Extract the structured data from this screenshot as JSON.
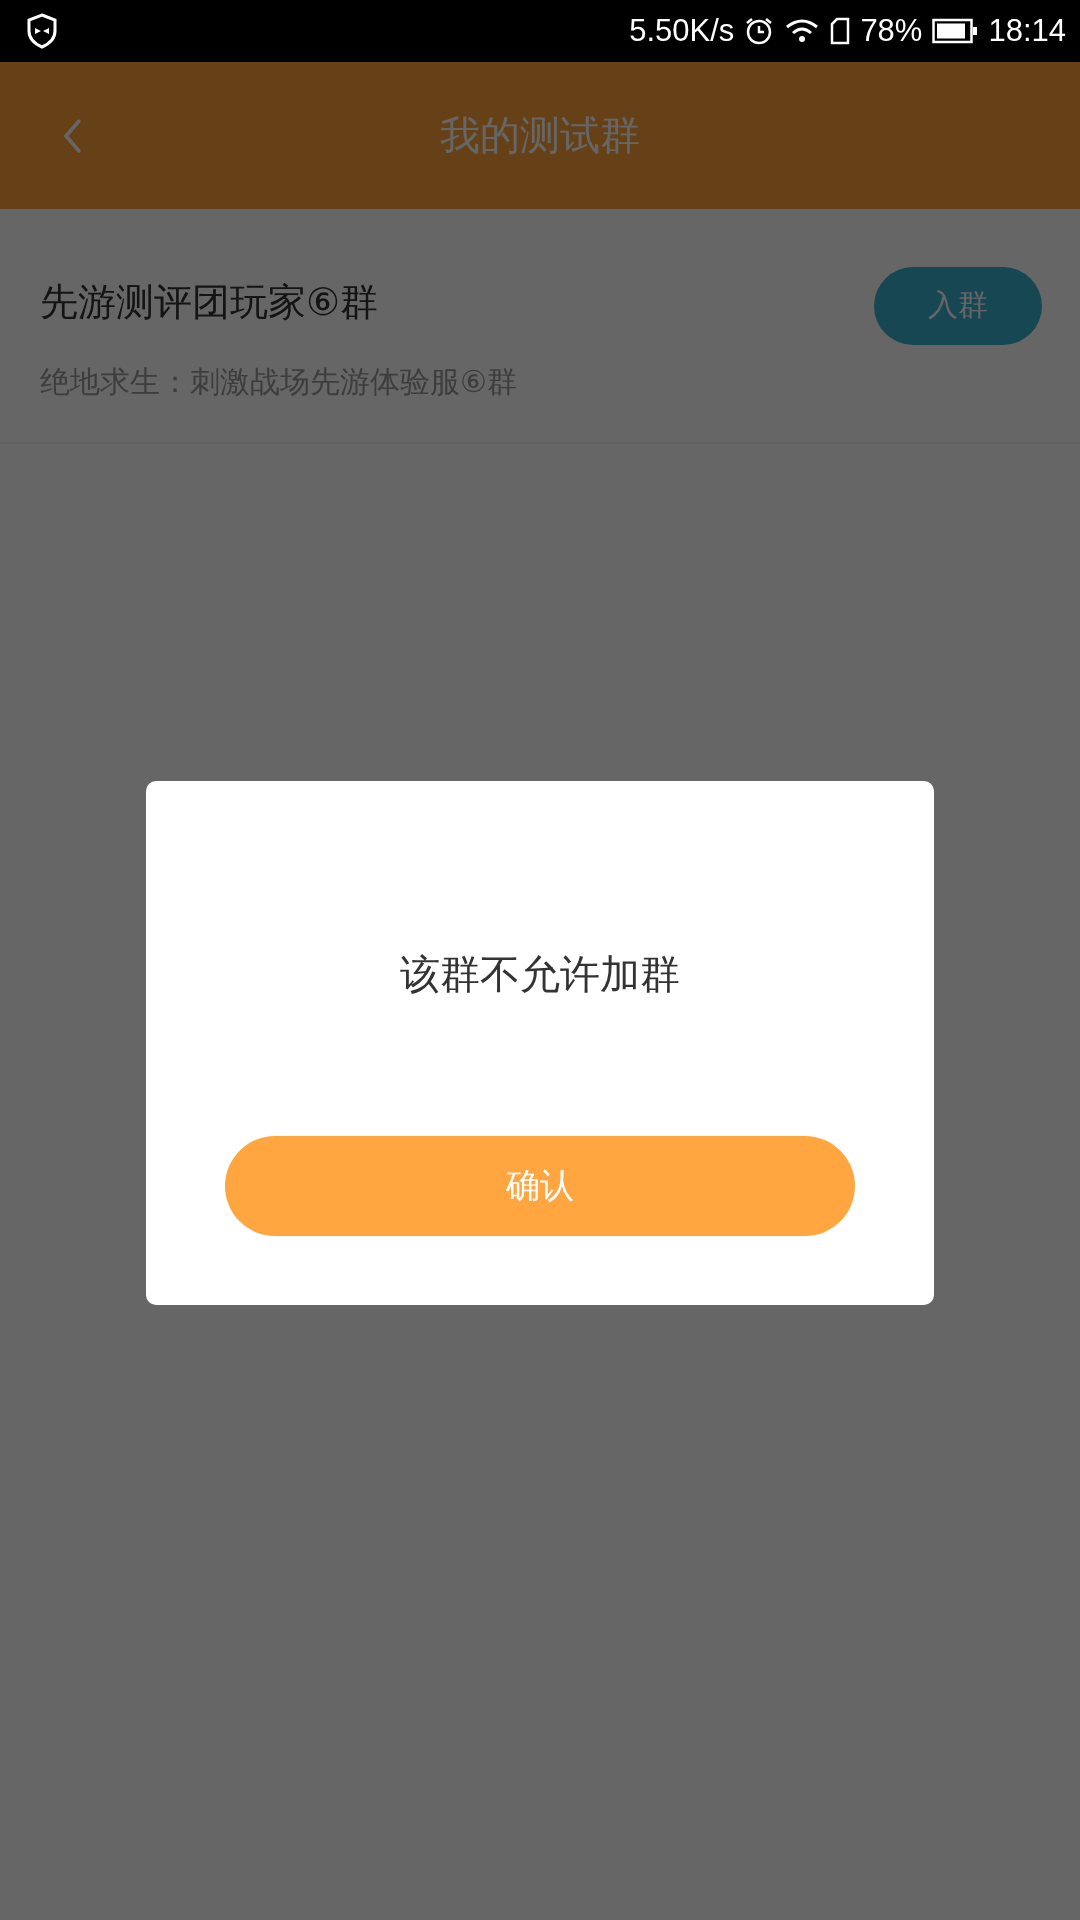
{
  "status_bar": {
    "net_speed": "5.50K/s",
    "battery": "78%",
    "time": "18:14"
  },
  "header": {
    "title": "我的测试群"
  },
  "groups": [
    {
      "name": "先游测评团玩家⑥群",
      "description": "绝地求生：刺激战场先游体验服⑥群",
      "button": "入群"
    }
  ],
  "dialog": {
    "message": "该群不允许加群",
    "confirm": "确认"
  }
}
